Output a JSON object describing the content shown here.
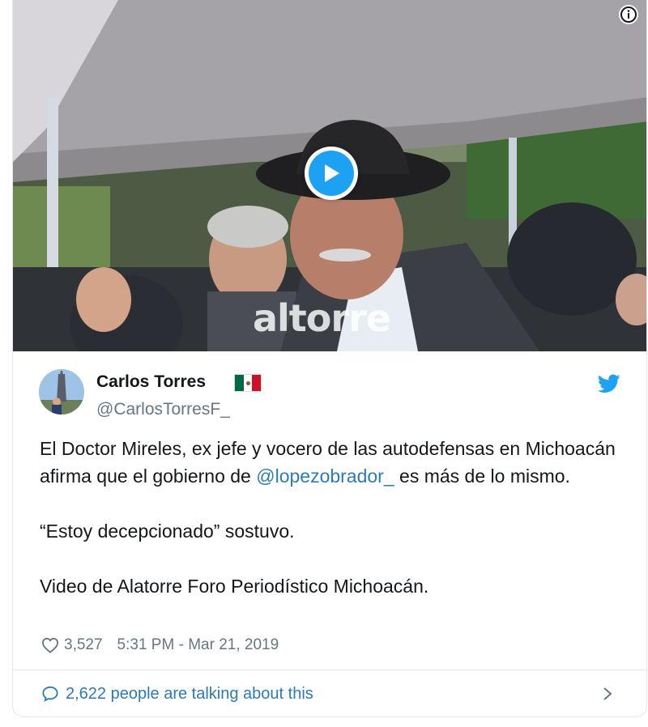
{
  "media": {
    "watermark": "altorre",
    "play_icon": "play-icon",
    "info_icon": "info-icon"
  },
  "tweet": {
    "author_name": "Carlos Torres",
    "author_handle": "@CarlosTorresF_",
    "flag": "mexico-flag",
    "text_part1": "El Doctor Mireles, ex jefe y vocero de las autodefensas en Michoacán afirma que el gobierno de ",
    "mention": "@lopezobrador_",
    "text_part2": " es más de lo mismo.",
    "quote_line": "“Estoy decepcionado” sostuvo.",
    "credit_line": "Video de Alatorre Foro Periodístico Michoacán.",
    "likes": "3,527",
    "timestamp": "5:31 PM - Mar 21, 2019"
  },
  "footer": {
    "talking": "2,622 people are talking about this"
  },
  "colors": {
    "twitter_blue": "#1da1f2",
    "link_blue": "#2b7bb9",
    "muted_gray": "#657786",
    "border": "#e1e8ed"
  }
}
